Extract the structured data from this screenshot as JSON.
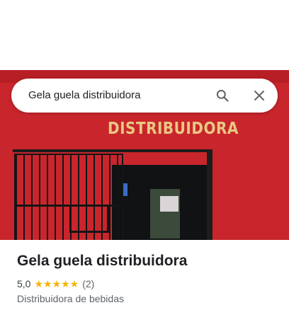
{
  "search": {
    "query": "Gela guela distribuidora",
    "search_icon": "search-icon",
    "close_icon": "close-icon"
  },
  "photo": {
    "sign_text": "DISTRIBUIDORA"
  },
  "place": {
    "name": "Gela guela distribuidora",
    "rating": "5,0",
    "stars": "★★★★★",
    "review_count": "(2)",
    "category": "Distribuidora de bebidas"
  },
  "colors": {
    "star": "#f4b400",
    "wall": "#c8262c",
    "icon": "#5f6368"
  }
}
